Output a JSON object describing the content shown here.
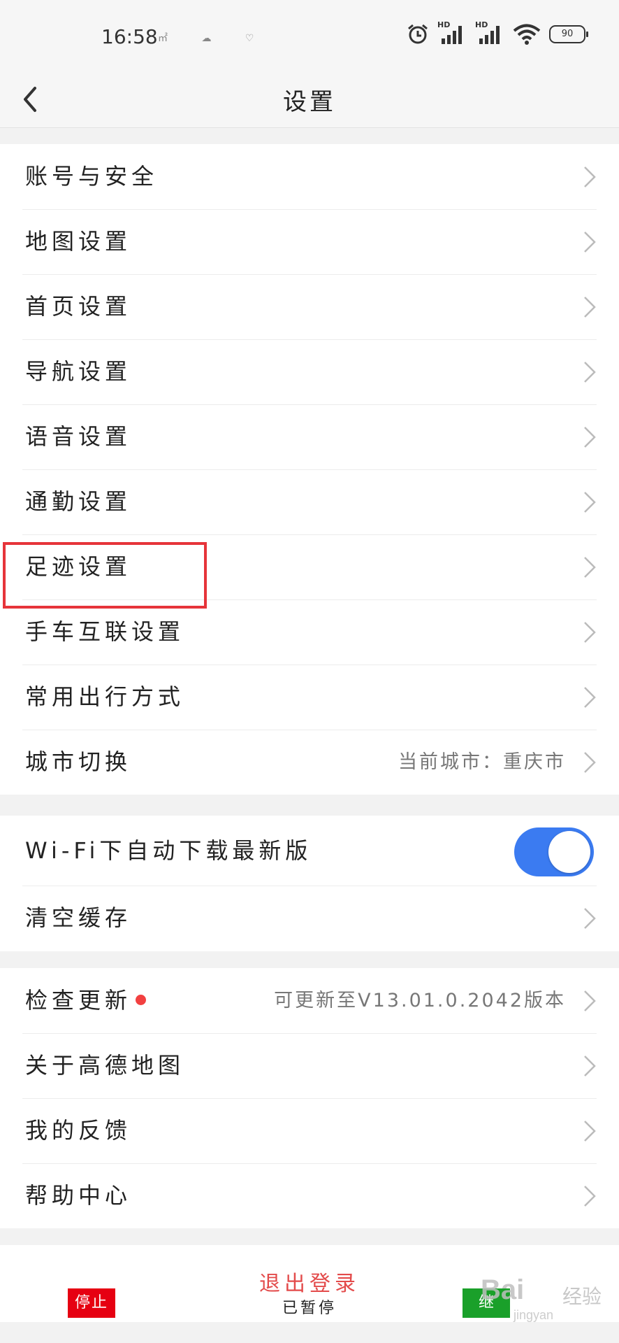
{
  "status_bar": {
    "time": "16:58",
    "small_icons": "㎡ ☁ ♡",
    "network_label_1": "HD",
    "network_label_2": "HD",
    "battery": "90"
  },
  "header": {
    "title": "设置"
  },
  "group1": [
    {
      "label": "账号与安全"
    },
    {
      "label": "地图设置"
    },
    {
      "label": "首页设置"
    },
    {
      "label": "导航设置"
    },
    {
      "label": "语音设置"
    },
    {
      "label": "通勤设置"
    },
    {
      "label": "足迹设置"
    },
    {
      "label": "手车互联设置"
    },
    {
      "label": "常用出行方式"
    },
    {
      "label": "城市切换",
      "value": "当前城市：重庆市"
    }
  ],
  "group2": {
    "wifi_label": "Wi-Fi下自动下载最新版",
    "wifi_toggle_on": true,
    "clear_cache_label": "清空缓存"
  },
  "group3": [
    {
      "label": "检查更新",
      "value": "可更新至V13.01.0.2042版本"
    },
    {
      "label": "关于高德地图"
    },
    {
      "label": "我的反馈"
    },
    {
      "label": "帮助中心"
    }
  ],
  "bottom": {
    "logout": "退出登录",
    "paused": "已暂停",
    "stop": "停止",
    "continue": "继",
    "watermark": "Bai",
    "watermark_cn": "经验",
    "watermark_sub": "jingyan"
  },
  "colors": {
    "accent": "#3b7bf1",
    "highlight": "#e6343a",
    "logout": "#e34b4b",
    "stop": "#e60012",
    "continue": "#1aa02a"
  }
}
